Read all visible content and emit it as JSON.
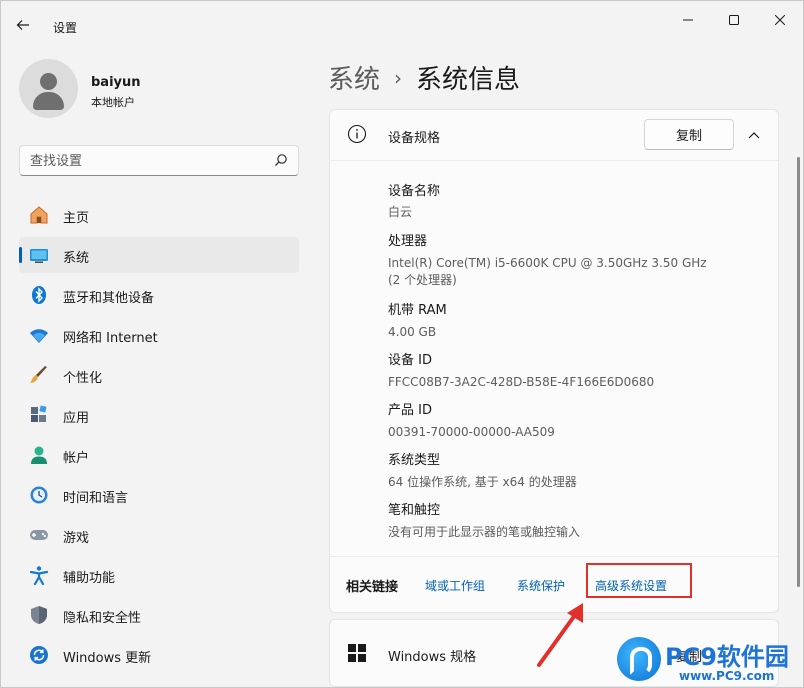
{
  "window": {
    "title": "设置"
  },
  "profile": {
    "name": "baiyun",
    "account_type": "本地帐户"
  },
  "search": {
    "placeholder": "查找设置"
  },
  "sidebar": {
    "items": [
      {
        "label": "主页",
        "icon": "home-icon",
        "active": false
      },
      {
        "label": "系统",
        "icon": "system-icon",
        "active": true
      },
      {
        "label": "蓝牙和其他设备",
        "icon": "bluetooth-icon",
        "active": false
      },
      {
        "label": "网络和 Internet",
        "icon": "wifi-icon",
        "active": false
      },
      {
        "label": "个性化",
        "icon": "brush-icon",
        "active": false
      },
      {
        "label": "应用",
        "icon": "apps-icon",
        "active": false
      },
      {
        "label": "帐户",
        "icon": "account-icon",
        "active": false
      },
      {
        "label": "时间和语言",
        "icon": "time-language-icon",
        "active": false
      },
      {
        "label": "游戏",
        "icon": "gamepad-icon",
        "active": false
      },
      {
        "label": "辅助功能",
        "icon": "accessibility-icon",
        "active": false
      },
      {
        "label": "隐私和安全性",
        "icon": "shield-icon",
        "active": false
      },
      {
        "label": "Windows 更新",
        "icon": "update-icon",
        "active": false
      }
    ]
  },
  "breadcrumb": {
    "parent": "系统",
    "separator": "›",
    "current": "系统信息"
  },
  "spec_card": {
    "title": "设备规格",
    "copy_label": "复制",
    "rows": [
      {
        "label": "设备名称",
        "value": "白云"
      },
      {
        "label": "处理器",
        "value": "Intel(R) Core(TM) i5-6600K CPU @ 3.50GHz   3.50 GHz",
        "value2": "(2 个处理器)"
      },
      {
        "label": "机带 RAM",
        "value": "4.00 GB"
      },
      {
        "label": "设备 ID",
        "value": "FFCC08B7-3A2C-428D-B58E-4F166E6D0680"
      },
      {
        "label": "产品 ID",
        "value": "00391-70000-00000-AA509"
      },
      {
        "label": "系统类型",
        "value": "64 位操作系统, 基于 x64 的处理器"
      },
      {
        "label": "笔和触控",
        "value": "没有可用于此显示器的笔或触控输入"
      }
    ]
  },
  "related": {
    "label": "相关链接",
    "links": [
      "域或工作组",
      "系统保护",
      "高级系统设置"
    ]
  },
  "windows_card": {
    "title": "Windows 规格",
    "copy_partial": "复制"
  },
  "watermark": {
    "title": "PC9软件园",
    "subtitle": "www.PC9.com"
  },
  "colors": {
    "accent": "#005fb8",
    "highlight": "#e0302b"
  }
}
